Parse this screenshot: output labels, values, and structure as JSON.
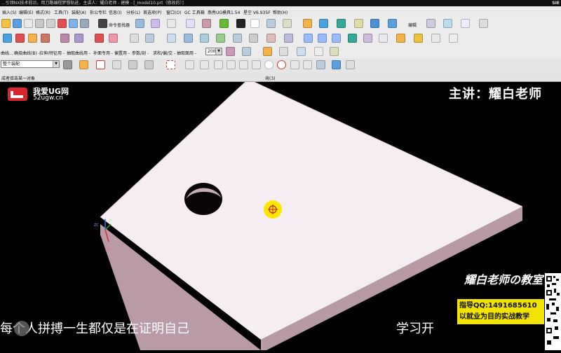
{
  "window": {
    "title": "...引领NX技术前沿，用刀路编程梦想轨迹，主讲人：耀白老师 - 建模 - [_model10.prt（修改的）]",
    "brand": "SIE"
  },
  "menubar": {
    "items": [
      {
        "label": "插入(S)"
      },
      {
        "label": "编辑(E)"
      },
      {
        "label": "格式(R)"
      },
      {
        "label": "工具(T)"
      },
      {
        "label": "装配(A)"
      },
      {
        "label": "拆公专栏"
      },
      {
        "label": "信息(I)"
      },
      {
        "label": "分析(L)"
      },
      {
        "label": "首选项(P)"
      },
      {
        "label": "窗口(O)"
      },
      {
        "label": "GC 工具箱"
      },
      {
        "label": "燕秀UG模具1.54"
      },
      {
        "label": "星空 V6.935F"
      },
      {
        "label": "帮助(H)"
      }
    ]
  },
  "toolbar": {
    "command_finder_label": "命令查找器",
    "edit_label": "编辑",
    "row3_labels": [
      "曲线...",
      "确接曲线(B) -",
      "拉伸/特征用 -",
      "抽取曲线用 -",
      "补面专用 -",
      "偏置用 -",
      "参数/剖 -",
      "求和/偏/交 -",
      "抽取面用 -"
    ],
    "count_value": "200",
    "filter_select": "整个装配",
    "status_text": "成者双击某一对象",
    "status_center": "块(3)"
  },
  "overlay": {
    "logo_text": "我爱UG网",
    "logo_url": "52ugw.cn",
    "presenter": "主讲：耀白老师",
    "subtitle_left": "每个人拼搏一生都仅是在证明自己",
    "subtitle_right": "学习开",
    "banner_title": "耀白老师の教室",
    "banner_qq": "指导QQ:1491685610",
    "banner_slogan": "以就业为目的实战教学"
  },
  "viewport": {
    "part_face_color": "#f6edf2",
    "part_side_color": "#b99aa6",
    "background": "#000000",
    "triad_axes": [
      "ZC",
      "YC",
      "XC"
    ]
  },
  "colors": {
    "highlight_yellow": "#f2e400",
    "cursor_marker": "#ffe600"
  }
}
